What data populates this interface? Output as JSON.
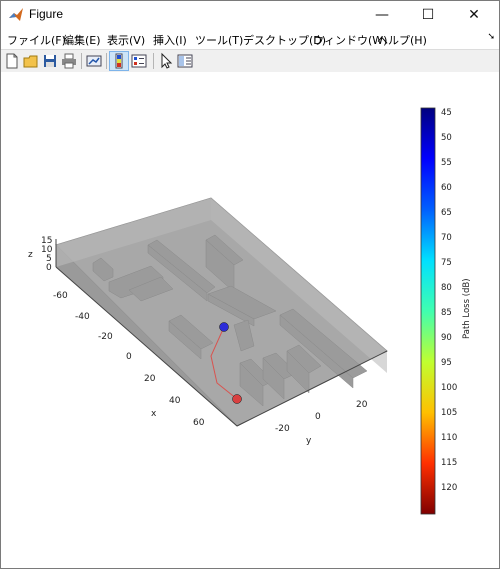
{
  "window": {
    "title": "Figure",
    "minimize_glyph": "—",
    "maximize_glyph": "☐",
    "close_glyph": "✕"
  },
  "menu": {
    "items": [
      {
        "label": "ファイル(F)"
      },
      {
        "label": "編集(E)"
      },
      {
        "label": "表示(V)"
      },
      {
        "label": "挿入(I)"
      },
      {
        "label": "ツール(T)"
      },
      {
        "label": "デスクトップ(D)"
      },
      {
        "label": "ウィンドウ(W)"
      },
      {
        "label": "ヘルプ(H)"
      }
    ],
    "overflow_arrow": "➘"
  },
  "toolbar": {
    "icons": [
      "new-figure-icon",
      "open-file-icon",
      "save-icon",
      "print-icon",
      "link-plot-icon",
      "insert-colorbar-icon",
      "insert-legend-icon",
      "pointer-arrow-icon",
      "property-inspector-icon"
    ]
  },
  "plot": {
    "z_axis_label": "z",
    "x_axis_label": "x",
    "y_axis_label": "y",
    "z_ticks": [
      "15",
      "10",
      "5",
      "0"
    ],
    "x_ticks": [
      "-60",
      "-40",
      "-20",
      "0",
      "20",
      "40",
      "60"
    ],
    "y_ticks": [
      "-20",
      "0",
      "20"
    ],
    "path_color": "#d9534f",
    "transmitter_color": "#2b2bd8",
    "receiver_color": "#d94040",
    "building_color": "#a6a6a6"
  },
  "colorbar": {
    "label": "Path Loss (dB)",
    "ticks": [
      "45",
      "50",
      "55",
      "60",
      "65",
      "70",
      "75",
      "80",
      "85",
      "90",
      "95",
      "100",
      "105",
      "110",
      "115",
      "120"
    ],
    "colormap": "jet",
    "top_color": "#0000a0",
    "bottom_color": "#a00000"
  }
}
